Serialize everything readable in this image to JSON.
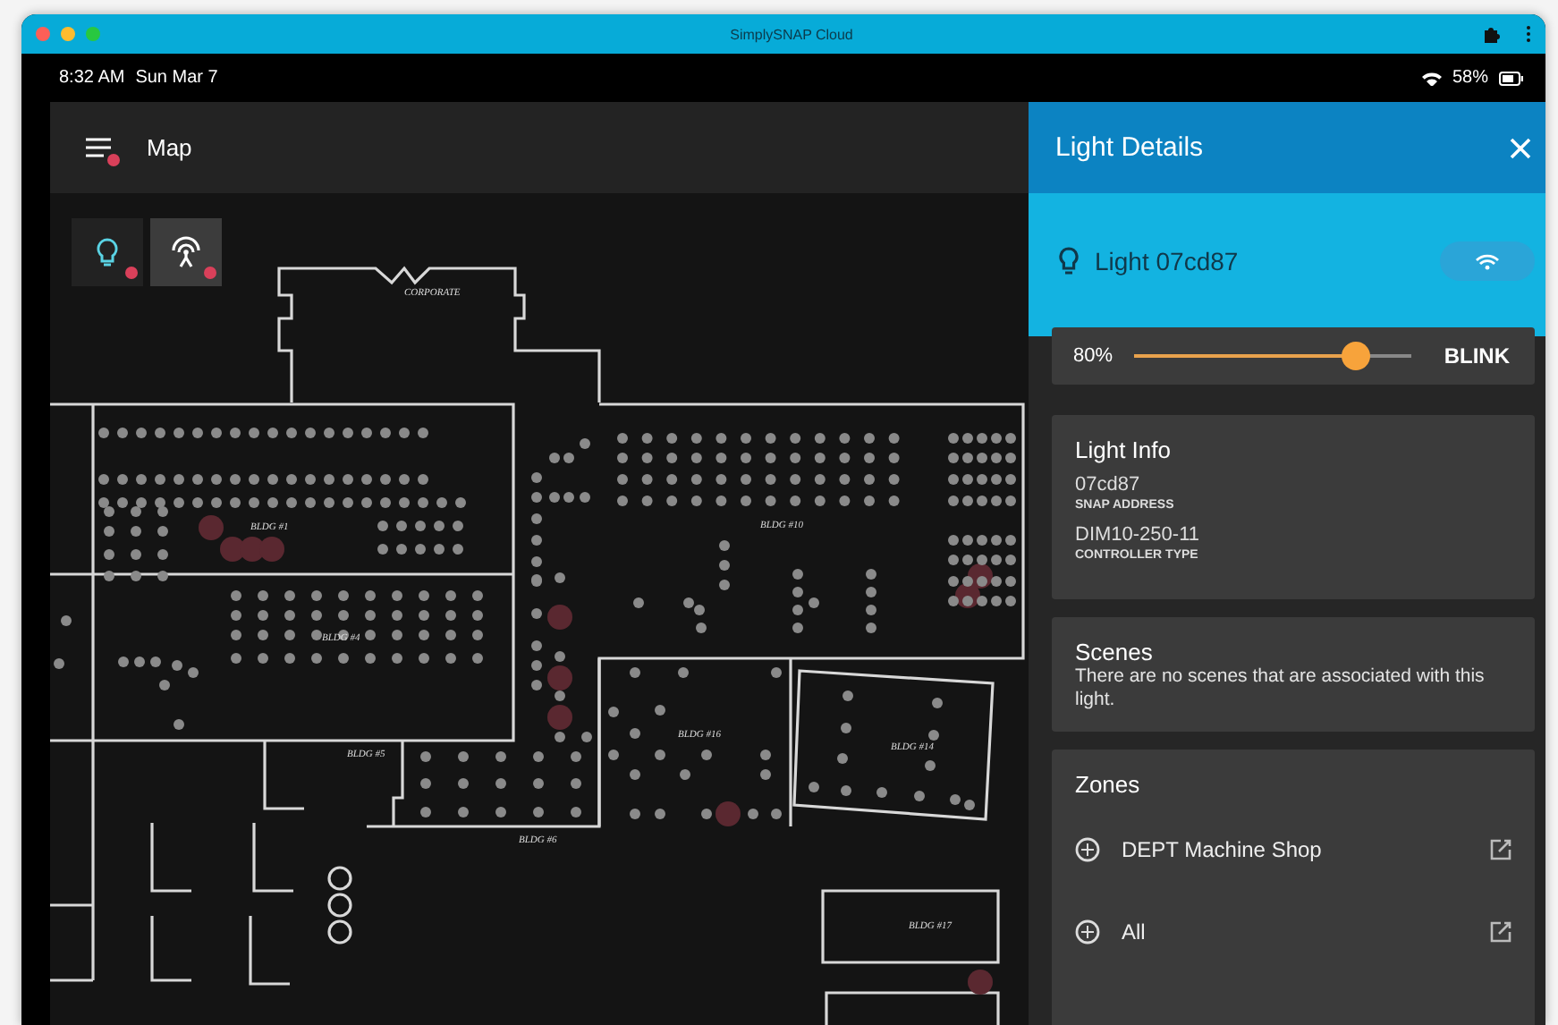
{
  "window": {
    "title": "SimplySNAP Cloud"
  },
  "status_bar": {
    "time": "8:32 AM",
    "date": "Sun Mar 7",
    "battery": "58%"
  },
  "app_bar": {
    "title": "Map",
    "menu_alert": true
  },
  "map_layers": [
    {
      "kind": "lights",
      "selected": false,
      "alert": true
    },
    {
      "kind": "gateways",
      "selected": true,
      "alert": true
    }
  ],
  "map": {
    "labels": [
      "CORPORATE",
      "BLDG #1",
      "BLDG #10",
      "BLDG #4",
      "BLDG #5",
      "BLDG #6",
      "BLDG #16",
      "BLDG #14",
      "BLDG #17"
    ]
  },
  "details": {
    "title": "Light Details",
    "light": {
      "name": "Light 07cd87"
    },
    "dimmer": {
      "reading": "80%",
      "level": 0.8,
      "action": "BLINK"
    },
    "info": {
      "title": "Light Info",
      "fields": [
        {
          "value": "07cd87",
          "label": "SNAP ADDRESS"
        },
        {
          "value": "DIM10-250-11",
          "label": "CONTROLLER TYPE"
        }
      ]
    },
    "scenes": {
      "title": "Scenes",
      "message": "There are no scenes that are associated with this light."
    },
    "zones": {
      "title": "Zones",
      "items": [
        {
          "name": "DEPT Machine Shop"
        },
        {
          "name": "All"
        }
      ]
    }
  }
}
